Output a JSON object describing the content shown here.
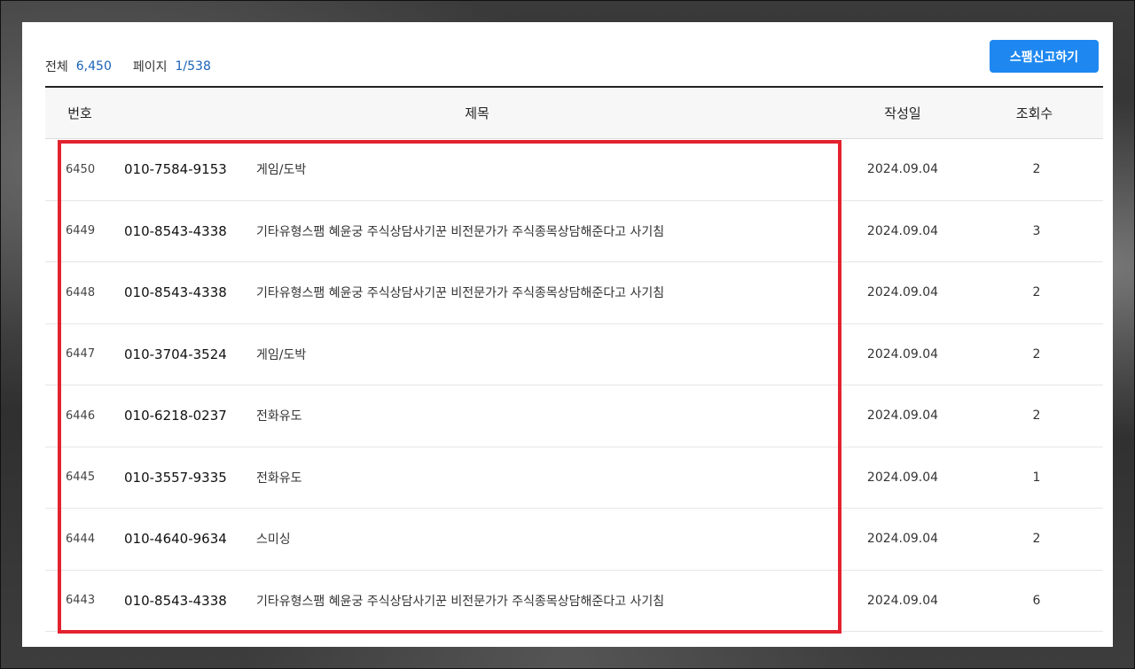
{
  "summary": {
    "total_label": "전체",
    "total_value": "6,450",
    "page_label": "페이지",
    "page_value": "1/538"
  },
  "report_button": {
    "label": "스팸신고하기",
    "color": "#1e88f0"
  },
  "table": {
    "headers": {
      "no": "번호",
      "title": "제목",
      "date": "작성일",
      "views": "조회수"
    },
    "rows": [
      {
        "no": "6450",
        "phone": "010-7584-9153",
        "title": "게임/도박",
        "date": "2024.09.04",
        "views": "2"
      },
      {
        "no": "6449",
        "phone": "010-8543-4338",
        "title": "기타유형스팸 혜윤궁 주식상담사기꾼 비전문가가 주식종목상담해준다고 사기침",
        "date": "2024.09.04",
        "views": "3"
      },
      {
        "no": "6448",
        "phone": "010-8543-4338",
        "title": "기타유형스팸 혜윤궁 주식상담사기꾼 비전문가가 주식종목상담해준다고 사기침",
        "date": "2024.09.04",
        "views": "2"
      },
      {
        "no": "6447",
        "phone": "010-3704-3524",
        "title": "게임/도박",
        "date": "2024.09.04",
        "views": "2"
      },
      {
        "no": "6446",
        "phone": "010-6218-0237",
        "title": "전화유도",
        "date": "2024.09.04",
        "views": "2"
      },
      {
        "no": "6445",
        "phone": "010-3557-9335",
        "title": "전화유도",
        "date": "2024.09.04",
        "views": "1"
      },
      {
        "no": "6444",
        "phone": "010-4640-9634",
        "title": "스미싱",
        "date": "2024.09.04",
        "views": "2"
      },
      {
        "no": "6443",
        "phone": "010-8543-4338",
        "title": "기타유형스팸 혜윤궁 주식상담사기꾼 비전문가가 주식종목상담해준다고 사기침",
        "date": "2024.09.04",
        "views": "6"
      }
    ]
  },
  "highlight_color": "#e32230"
}
